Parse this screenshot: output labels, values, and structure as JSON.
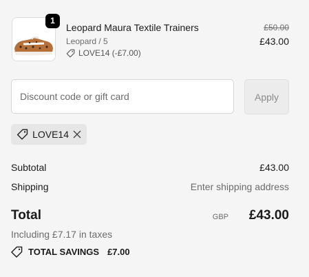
{
  "item": {
    "quantity": "1",
    "name": "Leopard Maura Textile Trainers",
    "variant": "Leopard / 5",
    "discount_line": "LOVE14 (-£7.00)",
    "original_price": "£50.00",
    "price": "£43.00"
  },
  "discount": {
    "placeholder": "Discount code or gift card",
    "apply_label": "Apply",
    "applied_code": "LOVE14"
  },
  "summary": {
    "subtotal_label": "Subtotal",
    "subtotal_value": "£43.00",
    "shipping_label": "Shipping",
    "shipping_value": "Enter shipping address",
    "total_label": "Total",
    "currency": "GBP",
    "total_value": "£43.00",
    "taxes_text": "Including £7.17 in taxes",
    "savings_label": "TOTAL SAVINGS",
    "savings_value": "£7.00"
  },
  "icons": {
    "tag": "tag-icon",
    "close": "close-icon",
    "savings": "savings-tag-icon"
  }
}
